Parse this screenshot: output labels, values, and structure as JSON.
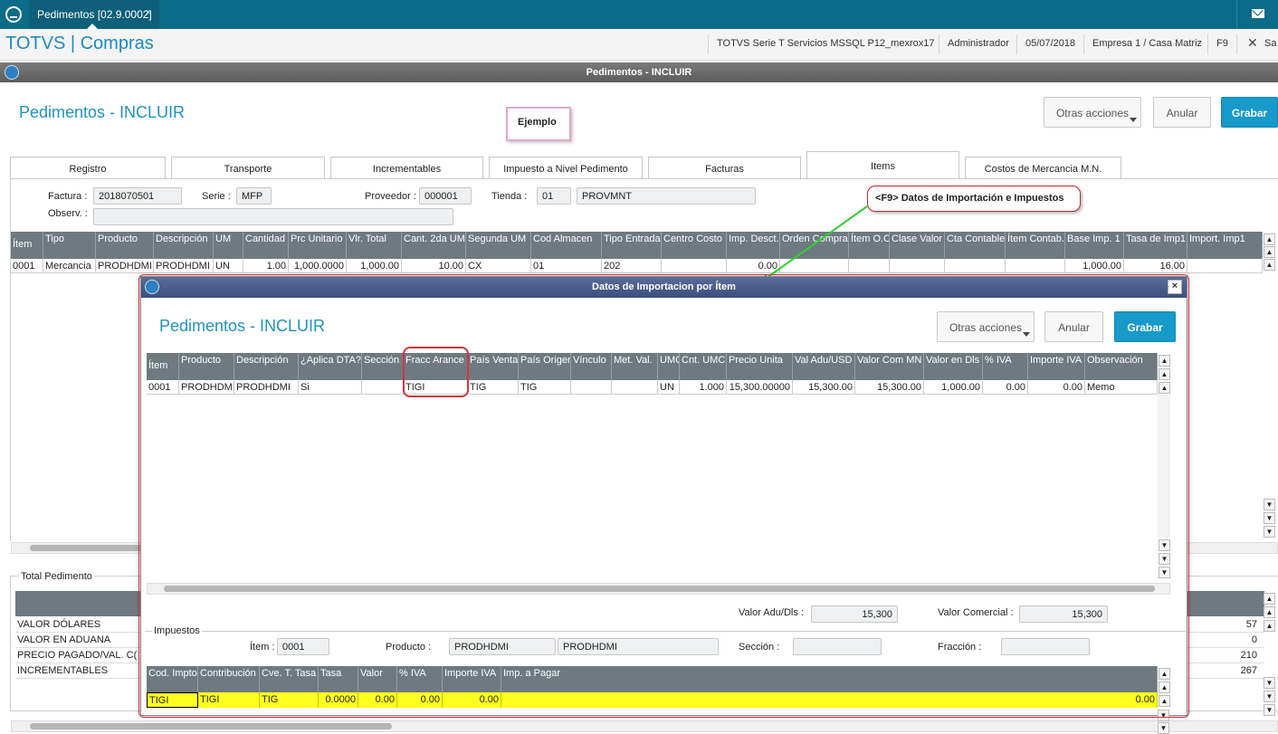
{
  "topbar": {
    "tab_label": "Pedimentos [02.9.0002]",
    "tab_close": "×"
  },
  "header": {
    "app_title": "TOTVS | Compras",
    "environment": "TOTVS Serie T Servicios MSSQL P12_mexrox17",
    "user": "Administrador",
    "date": "05/07/2018",
    "company": "Empresa 1 / Casa Matriz",
    "shortcut": "F9",
    "close": "✕",
    "exit": "Sa"
  },
  "window": {
    "title": "Pedimentos - INCLUIR"
  },
  "main": {
    "page_title": "Pedimentos - INCLUIR",
    "buttons": {
      "other_actions": "Otras acciones",
      "cancel": "Anular",
      "save": "Grabar"
    },
    "example_label": "Ejemplo",
    "tabs": [
      "Registro",
      "Transporte",
      "Incrementables",
      "Impuesto a Nivel Pedimento",
      "Facturas",
      "Items",
      "Costos de Mercancia M.N."
    ],
    "form": {
      "factura_label": "Factura :",
      "factura_value": "2018070501",
      "serie_label": "Serie :",
      "serie_value": "MFP",
      "proveedor_label": "Proveedor :",
      "proveedor_value": "000001",
      "tienda_label": "Tienda :",
      "tienda_value": "01",
      "tienda_name": "PROVMNT",
      "observ_label": "Observ. :",
      "observ_value": ""
    },
    "items_grid": {
      "columns": [
        "Ítem",
        "Tipo",
        "Producto",
        "Descripción",
        "UM",
        "Cantidad",
        "Prc Unitario",
        "Vlr. Total",
        "Cant. 2da UM",
        "Segunda UM",
        "Cod Almacen",
        "Tipo Entrada",
        "Centro Costo",
        "Imp. Desct.",
        "Orden Compra",
        "Ítem O.C.",
        "Clase Valor",
        "Cta Contable",
        "Ítem Contab.",
        "Base Imp. 1",
        "Tasa de Imp1",
        "Import. Imp1"
      ],
      "rows": [
        [
          "0001",
          "Mercancia",
          "PRODHDMI",
          "PRODHDMI",
          "UN",
          "1.00",
          "1,000.0000",
          "1,000.00",
          "10.00",
          "CX",
          "01",
          "202",
          "",
          "0.00",
          "",
          "",
          "",
          "",
          "",
          "1,000.00",
          "16.00",
          ""
        ]
      ]
    },
    "total_pedimento": {
      "title": "Total Pedimento",
      "rows": [
        {
          "label": "VALOR DÓLARES",
          "value": "57"
        },
        {
          "label": "VALOR EN ADUANA",
          "value": "0"
        },
        {
          "label": "PRECIO PAGADO/VAL. C(",
          "value": "210"
        },
        {
          "label": "INCREMENTABLES",
          "value": "267"
        }
      ]
    }
  },
  "callout": {
    "text": "<F9> Datos de Importación e Impuestos"
  },
  "dialog": {
    "title": "Datos de Importacion por Ítem",
    "page_title": "Pedimentos - INCLUIR",
    "buttons": {
      "other_actions": "Otras acciones",
      "cancel": "Anular",
      "save": "Grabar"
    },
    "grid": {
      "columns": [
        "Ítem",
        "Producto",
        "Descripción",
        "¿Aplica DTA?",
        "Sección",
        "Fracc Arance",
        "País Venta",
        "País Origen",
        "Vínculo",
        "Met. Val.",
        "UMC",
        "Cnt. UMC",
        "Precio Unita",
        "Val Adu/USD",
        "Valor Com MN",
        "Valor en Dls",
        "% IVA",
        "Importe IVA",
        "Observación"
      ],
      "rows": [
        [
          "0001",
          "PRODHDMI",
          "PRODHDMI",
          "Si",
          "",
          "TIGI",
          "TIG",
          "TIG",
          "",
          "",
          "UN",
          "1.000",
          "15,300.00000",
          "15,300.00",
          "15,300.00",
          "1,000.00",
          "0.00",
          "0.00",
          "Memo"
        ]
      ]
    },
    "valor_adu_label": "Valor Adu/Dls :",
    "valor_adu_value": "15,300",
    "valor_com_label": "Valor Comercial :",
    "valor_com_value": "15,300",
    "impuestos": {
      "title": "Impuestos",
      "item_label": "Ítem :",
      "item_value": "0001",
      "producto_label": "Producto :",
      "producto_code": "PRODHDMI",
      "producto_desc": "PRODHDMI",
      "seccion_label": "Sección :",
      "seccion_value": "",
      "fraccion_label": "Fracción :",
      "fraccion_value": "",
      "columns": [
        "Cod. Impto.",
        "Contribución",
        "Cve. T. Tasa",
        "Tasa",
        "Valor",
        "% IVA",
        "Importe IVA",
        "Imp. a Pagar"
      ],
      "rows": [
        [
          "TIGI",
          "TIGI",
          "TIG",
          "0.0000",
          "0.00",
          "0.00",
          "0.00",
          "0.00"
        ]
      ]
    }
  },
  "colors": {
    "topbar": "#0b6b88",
    "accent": "#1799c9",
    "grid_header": "#6e7a80",
    "highlight_row": "#ffff20",
    "annotation_red": "#d3353d",
    "arrow_green": "#2fd12f"
  }
}
